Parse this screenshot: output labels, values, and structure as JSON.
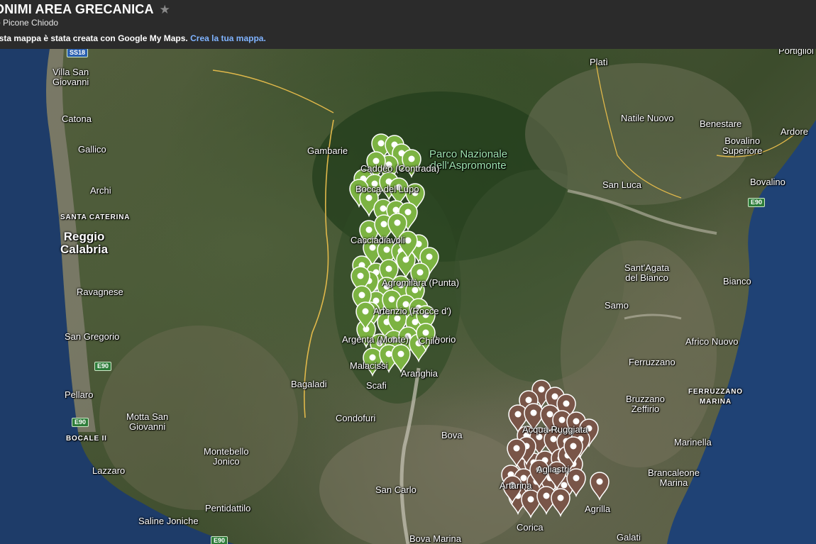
{
  "header": {
    "title": "ONIMI AREA GRECANICA",
    "star_icon": "star-icon",
    "author": "o Picone Chiodo",
    "notice_text": "esta mappa è stata creata con Google My Maps.",
    "notice_link": "Crea la tua mappa."
  },
  "colors": {
    "green_pins": "#7cb342",
    "brown_pins": "#795548",
    "sea": "#1f3d6b",
    "header_bg": "#2b2b2b",
    "link": "#7fb3ff"
  },
  "roads": [
    "SS18",
    "E90",
    "E90",
    "E90",
    "E90"
  ],
  "places": [
    "Villa San\nGiovanni",
    "Catona",
    "Gallico",
    "Archi",
    "SANTA CATERINA",
    "Reggio\nCalabria",
    "Ravagnese",
    "San Gregorio",
    "Pellaro",
    "Motta San\nGiovanni",
    "BOCALE II",
    "Lazzaro",
    "Montebello\nJonico",
    "Pentidattilo",
    "Saline Joniche",
    "Gambarie",
    "Parco Nazionale\ndell'Aspromonte",
    "Bagaladi",
    "Condofuri",
    "Bova",
    "San Carlo",
    "Bova Marina",
    "Platì",
    "Portigliol",
    "Natile Nuovo",
    "Benestare",
    "Bovalino\nSuperiore",
    "Ardore",
    "San Luca",
    "Bovalino",
    "Sant'Agata\ndel Bianco",
    "Bianco",
    "Samo",
    "Africo Nuovo",
    "Ferruzzano",
    "Bruzzano\nZeffirio",
    "FERRUZZANO\nMARINA",
    "Marinella",
    "Brancaleone\nMarina",
    "Galati",
    "Chorio",
    "Scafi"
  ],
  "marker_labels": [
    "Caddèo (Contrada)",
    "Bocca del Lupo",
    "Cacciadiavoli",
    "Agromilàra (Punta)",
    "Artenzio (Rocce d')",
    "Argenta (Monte)",
    "Chilò",
    "Malacissi",
    "Aranghia",
    "Acqua Ruggiata",
    "Agliastri",
    "Artarina",
    "Agrilla",
    "Corica"
  ]
}
